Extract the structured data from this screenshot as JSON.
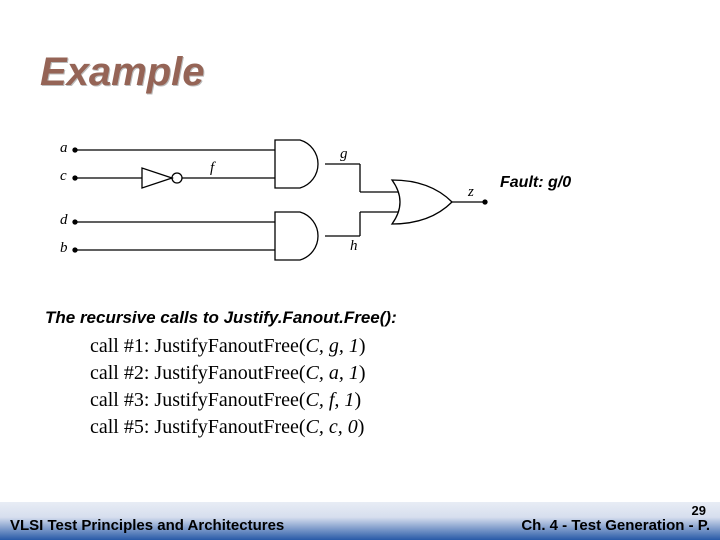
{
  "title": "Example",
  "fault_label": "Fault: g/0",
  "subheading": "The recursive calls to Justify.Fanout.Free():",
  "calls": [
    {
      "num": "#1",
      "args": "C, g, 1"
    },
    {
      "num": "#2",
      "args": "C, a, 1"
    },
    {
      "num": "#3",
      "args": "C, f, 1"
    },
    {
      "num": "#5",
      "args": "C, c, 0"
    }
  ],
  "circuit": {
    "inputs": [
      "a",
      "c",
      "d",
      "b"
    ],
    "internal": [
      "f",
      "g",
      "h"
    ],
    "output": "z",
    "gates": {
      "not_in_c_out_f": "NOT",
      "and_top_in_a_f_out_g": "AND",
      "and_bot_in_d_b_out_h": "AND",
      "or_in_g_h_out_z": "OR"
    }
  },
  "footer": {
    "left": "VLSI Test Principles and Architectures",
    "right": "Ch. 4 - Test Generation - P.",
    "slide_number": "29"
  }
}
